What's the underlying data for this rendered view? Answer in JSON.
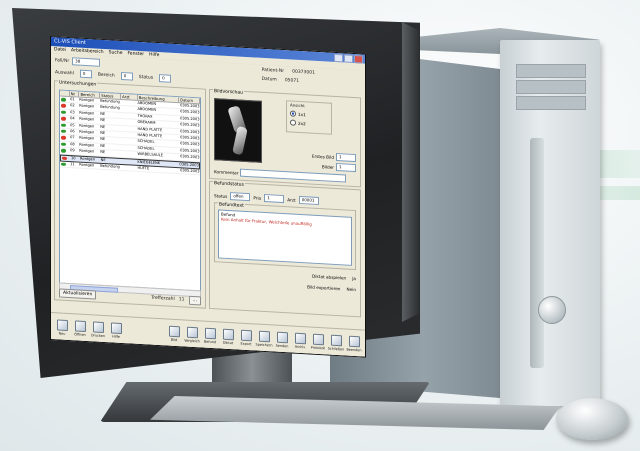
{
  "window": {
    "title": "CL-VIS Client",
    "menu": [
      "Datei",
      "Arbeitsbereich",
      "Suche",
      "Fenster",
      "Hilfe"
    ]
  },
  "header": {
    "case_label": "Fall/Nr",
    "case_value": "38",
    "patient_label": "Patient-Nr",
    "patient_value": "00373001",
    "date_label": "Datum",
    "date_value": "05071",
    "filters": [
      {
        "label": "Auswahl",
        "value": "0"
      },
      {
        "label": "Bereich",
        "value": "0"
      },
      {
        "label": "Status",
        "value": "0"
      }
    ]
  },
  "studies": {
    "group_title": "Untersuchungen",
    "columns": [
      "",
      "Nr",
      "Bereich",
      "Status",
      "Arzt",
      "Beschreibung",
      "Datum"
    ],
    "rows": [
      {
        "status_color": "#2e9b2e",
        "nr": "01",
        "area": "Rontgen",
        "state": "Befundung",
        "doc": "",
        "desc": "ABDOMEN",
        "date": "0305.2003"
      },
      {
        "status_color": "#d93a2a",
        "nr": "02",
        "area": "Rontgen",
        "state": "Befundung",
        "doc": "",
        "desc": "ABDOMEN",
        "date": "0305.2003"
      },
      {
        "status_color": "#2e9b2e",
        "nr": "03",
        "area": "Rontgen",
        "state": "NE",
        "doc": "",
        "desc": "THORAX",
        "date": "0305.2003"
      },
      {
        "status_color": "#d93a2a",
        "nr": "04",
        "area": "Rontgen",
        "state": "NE",
        "doc": "",
        "desc": "OBERARM",
        "date": "0305.2003"
      },
      {
        "status_color": "#2e9b2e",
        "nr": "05",
        "area": "Rontgen",
        "state": "NE",
        "doc": "",
        "desc": "HAND PLATTE",
        "date": "0305.2003"
      },
      {
        "status_color": "#2e9b2e",
        "nr": "06",
        "area": "Rontgen",
        "state": "NE",
        "doc": "",
        "desc": "HAND PLATTE",
        "date": "0305.2003"
      },
      {
        "status_color": "#d93a2a",
        "nr": "07",
        "area": "Rontgen",
        "state": "NE",
        "doc": "",
        "desc": "SCHADEL",
        "date": "0305.2003"
      },
      {
        "status_color": "#2e9b2e",
        "nr": "08",
        "area": "Rontgen",
        "state": "NE",
        "doc": "",
        "desc": "SCHADEL",
        "date": "0305.2003"
      },
      {
        "status_color": "#2e9b2e",
        "nr": "09",
        "area": "Rontgen",
        "state": "NE",
        "doc": "",
        "desc": "WIRBELSAULE",
        "date": "0305.2003"
      },
      {
        "status_color": "#d93a2a",
        "nr": "10",
        "area": "Rontgen",
        "state": "NE",
        "doc": "",
        "desc": "KNIEGELENK",
        "date": "0305.2003"
      },
      {
        "status_color": "#2e9b2e",
        "nr": "11",
        "area": "Rontgen",
        "state": "Befundung",
        "doc": "",
        "desc": "HUFTE",
        "date": "0305.2003"
      }
    ],
    "selected_index": 9,
    "footer_left": "Aktualisieren",
    "footer_mid": "Trefferzahl",
    "footer_count": "11"
  },
  "preview": {
    "group_title": "Bildvorschau",
    "view_group": "Ansicht",
    "options": [
      "1x1",
      "2x2"
    ],
    "selected_option": 0,
    "first_image_label": "Erstes Bild",
    "first_image_value": "1",
    "max_label": "Bilder",
    "max_value": "1",
    "comment_label": "Kommentar"
  },
  "report": {
    "group_title": "Befundstatus",
    "state_label": "Status",
    "state_value": "offen",
    "priority_label": "Prio",
    "priority_value": "1",
    "doctor_label": "Arzt",
    "doctor_value": "00001",
    "findings_title": "Befundtext",
    "findings_header": "Befund",
    "findings_text": "Kein Anhalt für Fraktur, Weichteile unauffällig",
    "dictation_label": "Diktat abspielen",
    "dictation_value": "Ja",
    "export_label": "Bild exportieren",
    "export_value": "Nein"
  },
  "toolbar": {
    "left": [
      "Neu",
      "Öffnen",
      "Drucken",
      "Hilfe"
    ],
    "right": [
      "Bild",
      "Vergleich",
      "Befund",
      "Diktat",
      "Export",
      "Speichern",
      "Senden",
      "Archiv",
      "Protokoll",
      "Schließen",
      "Beenden"
    ]
  },
  "colors": {
    "title_start": "#1d4fb8",
    "title_end": "#5b86d8",
    "status_ok": "#2e9b2e",
    "status_alert": "#d93a2a",
    "findings_text_color": "#c0231b"
  }
}
